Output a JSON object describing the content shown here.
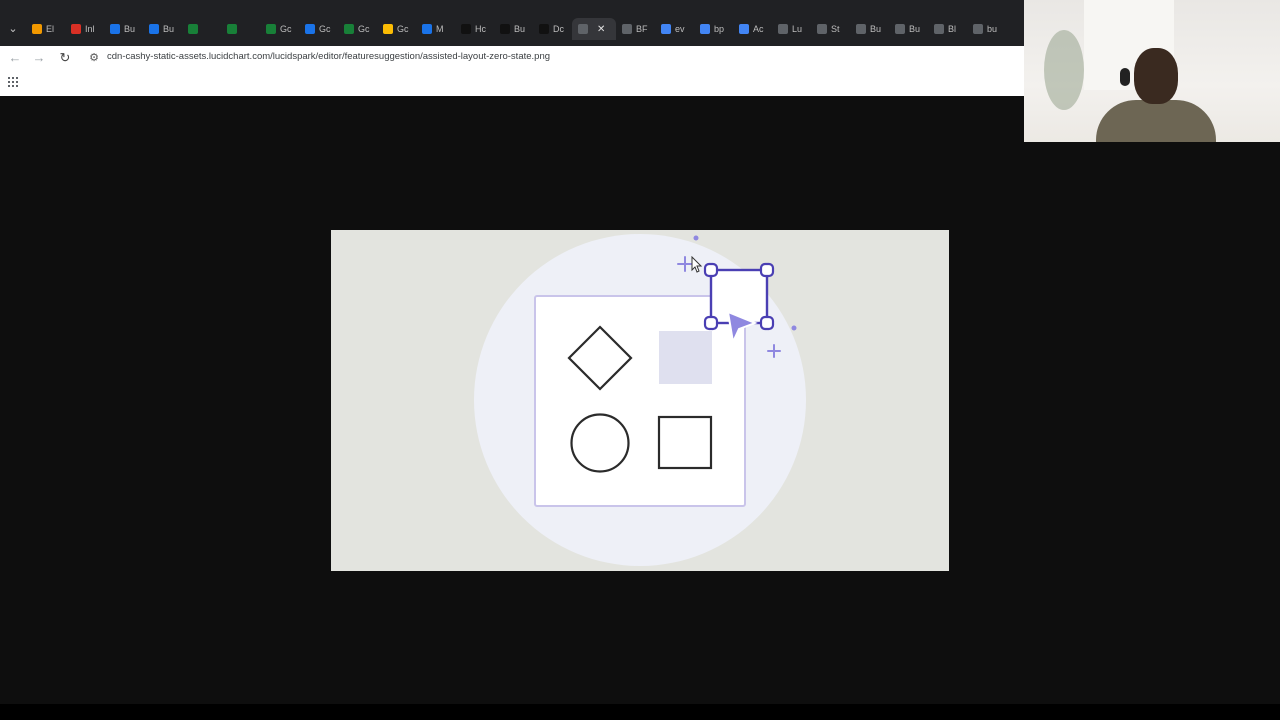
{
  "browser": {
    "tab_menu_icon": "chevron-down-icon",
    "tabs": [
      {
        "label": "El",
        "favicon_color": "#f29900",
        "active": false
      },
      {
        "label": "Inl",
        "favicon_color": "#d93025",
        "active": false
      },
      {
        "label": "Bu",
        "favicon_color": "#1a73e8",
        "active": false
      },
      {
        "label": "Bu",
        "favicon_color": "#1a73e8",
        "active": false
      },
      {
        "label": "",
        "favicon_color": "#188038",
        "active": false
      },
      {
        "label": "",
        "favicon_color": "#188038",
        "active": false
      },
      {
        "label": "Gc",
        "favicon_color": "#188038",
        "active": false
      },
      {
        "label": "Gc",
        "favicon_color": "#1a73e8",
        "active": false
      },
      {
        "label": "Gc",
        "favicon_color": "#188038",
        "active": false
      },
      {
        "label": "Gc",
        "favicon_color": "#fbbc04",
        "active": false
      },
      {
        "label": "M",
        "favicon_color": "#1a73e8",
        "active": false
      },
      {
        "label": "Hc",
        "favicon_color": "#111111",
        "active": false
      },
      {
        "label": "Bu",
        "favicon_color": "#111111",
        "active": false
      },
      {
        "label": "Dc",
        "favicon_color": "#111111",
        "active": false
      },
      {
        "label": "",
        "favicon_color": "#5f6368",
        "active": true
      },
      {
        "label": "BF",
        "favicon_color": "#5f6368",
        "active": false
      },
      {
        "label": "ev",
        "favicon_color": "#4285f4",
        "active": false
      },
      {
        "label": "bp",
        "favicon_color": "#4285f4",
        "active": false
      },
      {
        "label": "Ac",
        "favicon_color": "#4285f4",
        "active": false
      },
      {
        "label": "Lu",
        "favicon_color": "#5f6368",
        "active": false
      },
      {
        "label": "St",
        "favicon_color": "#5f6368",
        "active": false
      },
      {
        "label": "Bu",
        "favicon_color": "#5f6368",
        "active": false
      },
      {
        "label": "Bu",
        "favicon_color": "#5f6368",
        "active": false
      },
      {
        "label": "Bl",
        "favicon_color": "#5f6368",
        "active": false
      },
      {
        "label": "bu",
        "favicon_color": "#5f6368",
        "active": false
      }
    ],
    "close_tab_glyph": "✕",
    "back_glyph": "←",
    "forward_glyph": "→",
    "reload_glyph": "↻",
    "site_info_glyph": "⚙",
    "url": "cdn-cashy-static-assets.lucidchart.com/lucidspark/editor/featuresuggestion/assisted-layout-zero-state.png",
    "apps_icon": "apps-grid-icon"
  },
  "illustration": {
    "background": "#e3e4df",
    "circle_color": "#eef0f7",
    "accent": "#5b4fc4",
    "accent_light": "#8f88e0",
    "shapes": [
      "diamond",
      "placeholder-square",
      "circle",
      "square",
      "selected-square"
    ]
  }
}
